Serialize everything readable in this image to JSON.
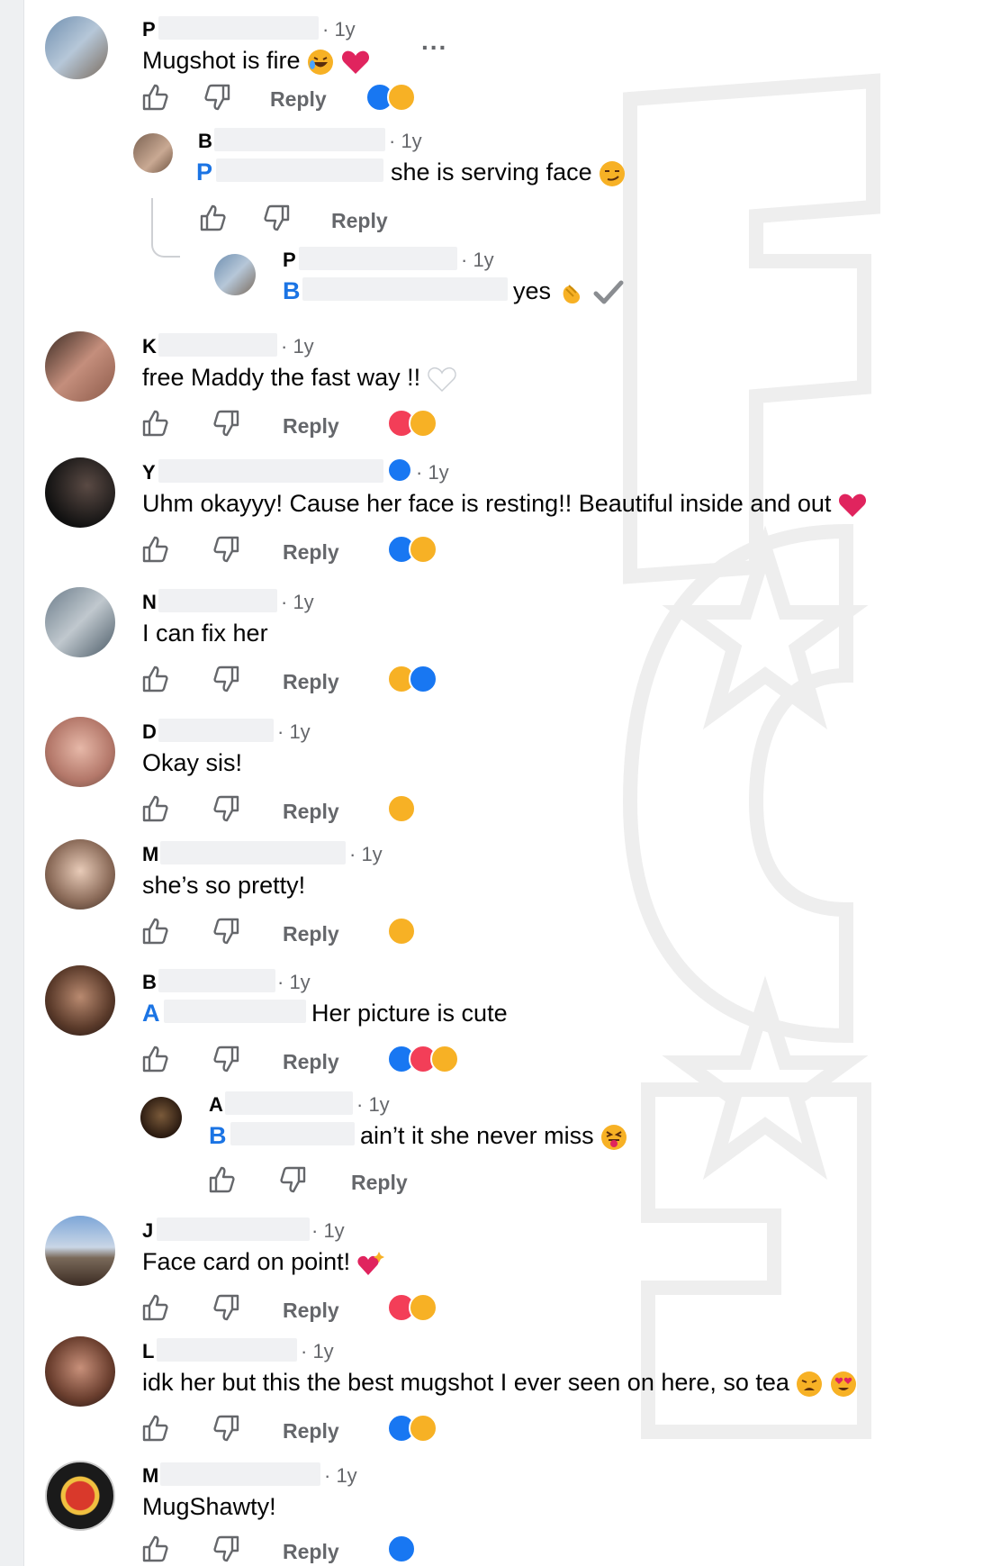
{
  "actions": {
    "reply": "Reply",
    "more": "..."
  },
  "comments": [
    {
      "initial": "P",
      "time": "· 1y",
      "text": "Mugshot is fire",
      "emojis": "haha,heart",
      "reactions": [
        "like",
        "care"
      ]
    },
    {
      "initial": "B",
      "mention": "P",
      "time": "· 1y",
      "text": "she is serving face",
      "emojis": "smirk",
      "reactions": []
    },
    {
      "initial": "P",
      "mention": "B",
      "time": "· 1y",
      "text": "yes",
      "emojis": "clap,check",
      "reactions": []
    },
    {
      "initial": "K",
      "time": "· 1y",
      "text": "free Maddy the fast way !!",
      "emojis": "whiteheart",
      "reactions": [
        "love",
        "care"
      ]
    },
    {
      "initial": "Y",
      "time": "· 1y",
      "text": "Uhm okayyy! Cause her face is resting!! Beautiful inside and out",
      "emojis": "heart",
      "reactions": [
        "like",
        "care"
      ],
      "verified": true
    },
    {
      "initial": "N",
      "time": "· 1y",
      "text": "I can fix her",
      "emojis": "",
      "reactions": [
        "haha",
        "like"
      ]
    },
    {
      "initial": "D",
      "time": "· 1y",
      "text": "Okay sis!",
      "emojis": "",
      "reactions": [
        "haha"
      ]
    },
    {
      "initial": "M",
      "time": "· 1y",
      "text": "she’s so pretty!",
      "emojis": "",
      "reactions": [
        "care"
      ]
    },
    {
      "initial": "B",
      "mention": "A",
      "time": "· 1y",
      "text": "Her picture is cute",
      "emojis": "",
      "reactions": [
        "like",
        "love",
        "care"
      ]
    },
    {
      "initial": "A",
      "mention": "B",
      "time": "· 1y",
      "text": "ain’t it she never miss",
      "emojis": "tongue",
      "reactions": []
    },
    {
      "initial": "J",
      "time": "· 1y",
      "text": "Face card on point!",
      "emojis": "heartsparkle",
      "reactions": [
        "love",
        "care"
      ]
    },
    {
      "initial": "L",
      "time": "· 1y",
      "text": "idk her but this the best mugshot I ever seen on here, so tea",
      "emojis": "weary,hearteyes",
      "reactions": [
        "like",
        "care"
      ]
    },
    {
      "initial": "M",
      "time": "· 1y",
      "text": "MugShawty!",
      "emojis": "",
      "reactions": [
        "like"
      ]
    }
  ]
}
